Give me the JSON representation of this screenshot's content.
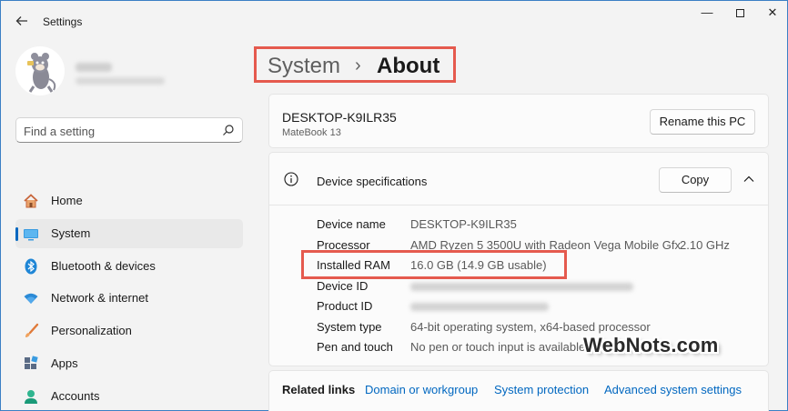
{
  "window": {
    "app_title": "Settings",
    "back_icon": "arrow-left-icon",
    "minimize_glyph": "—",
    "close_glyph": "✕"
  },
  "sidebar": {
    "search_placeholder": "Find a setting",
    "items": [
      {
        "label": "Home",
        "icon": "home-icon",
        "selected": false
      },
      {
        "label": "System",
        "icon": "monitor-icon",
        "selected": true
      },
      {
        "label": "Bluetooth & devices",
        "icon": "bluetooth-icon",
        "selected": false
      },
      {
        "label": "Network & internet",
        "icon": "wifi-icon",
        "selected": false
      },
      {
        "label": "Personalization",
        "icon": "brush-icon",
        "selected": false
      },
      {
        "label": "Apps",
        "icon": "apps-icon",
        "selected": false
      },
      {
        "label": "Accounts",
        "icon": "person-icon",
        "selected": false
      }
    ]
  },
  "breadcrumb": {
    "parent": "System",
    "separator": "›",
    "current": "About"
  },
  "device": {
    "name": "DESKTOP-K9ILR35",
    "model": "MateBook 13",
    "rename_label": "Rename this PC"
  },
  "specs": {
    "title": "Device specifications",
    "copy_label": "Copy",
    "rows": [
      {
        "label": "Device name",
        "value": "DESKTOP-K9ILR35",
        "extra": ""
      },
      {
        "label": "Processor",
        "value": "AMD Ryzen 5 3500U with Radeon Vega Mobile Gfx",
        "extra": "2.10 GHz"
      },
      {
        "label": "Installed RAM",
        "value": "16.0 GB (14.9 GB usable)",
        "extra": ""
      },
      {
        "label": "Device ID",
        "value": "",
        "extra": ""
      },
      {
        "label": "Product ID",
        "value": "",
        "extra": ""
      },
      {
        "label": "System type",
        "value": "64-bit operating system, x64-based processor",
        "extra": ""
      },
      {
        "label": "Pen and touch",
        "value": "No pen or touch input is available fo",
        "extra": ""
      }
    ]
  },
  "related_links": {
    "label": "Related links",
    "links": [
      "Domain or workgroup",
      "System protection",
      "Advanced system settings"
    ]
  },
  "watermark": "WebNots.com",
  "colors": {
    "accent": "#0067c0",
    "highlight": "#e55a4e",
    "background": "#f3f3f3",
    "card": "#fbfbfb"
  }
}
